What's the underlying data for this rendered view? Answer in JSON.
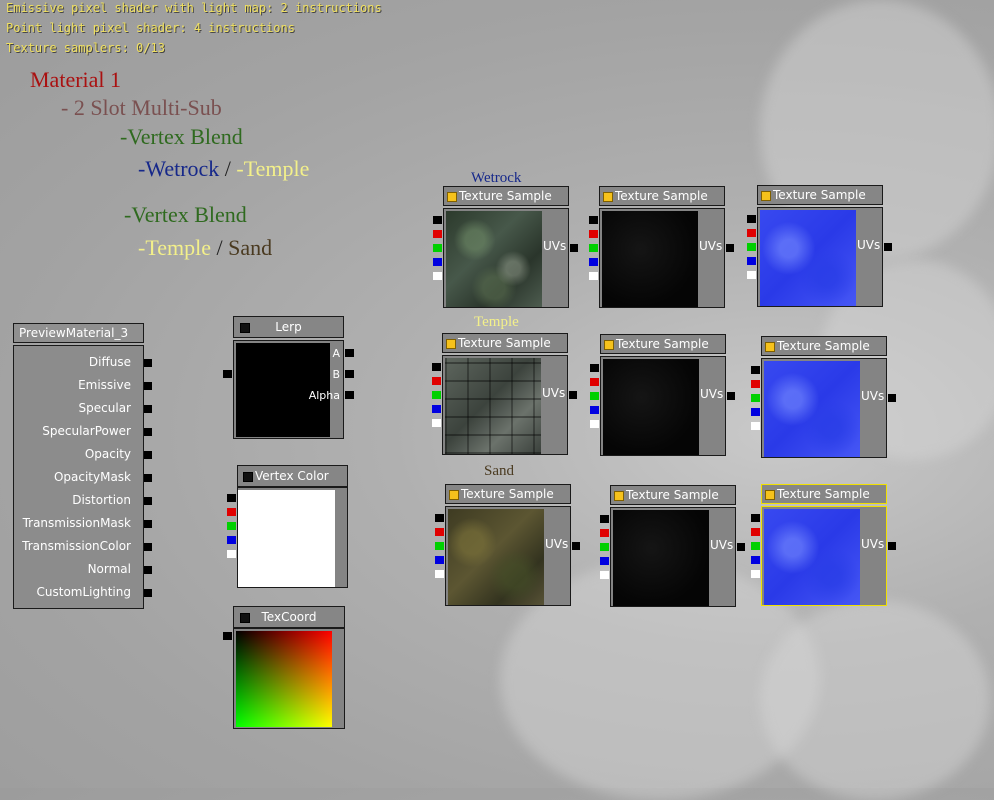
{
  "stats": {
    "line1": "Emissive pixel shader with light map: 2 instructions",
    "line2": "Point light pixel shader: 4 instructions",
    "line3": "Texture samplers: 0/13"
  },
  "notes": {
    "material": "Material 1",
    "multisub": "- 2 Slot Multi-Sub",
    "vertex_blend_1": "-Vertex Blend",
    "wetrock": "-Wetrock",
    "slash": " / ",
    "temple_1": "-Temple",
    "vertex_blend_2": "-Vertex Blend",
    "temple_2": "-Temple",
    "sand": "Sand"
  },
  "section_labels": {
    "wetrock": "Wetrock",
    "temple": "Temple",
    "sand": "Sand"
  },
  "preview_material": {
    "title": "PreviewMaterial_3",
    "inputs": [
      "Diffuse",
      "Emissive",
      "Specular",
      "SpecularPower",
      "Opacity",
      "OpacityMask",
      "Distortion",
      "TransmissionMask",
      "TransmissionColor",
      "Normal",
      "CustomLighting"
    ]
  },
  "lerp": {
    "title": "Lerp",
    "inputs": [
      "A",
      "B",
      "Alpha"
    ]
  },
  "vertex_color": {
    "title": "Vertex Color"
  },
  "texcoord": {
    "title": "TexCoord"
  },
  "texture_sample": {
    "title": "Texture Sample",
    "uvs_label": "UVs"
  },
  "colors": {
    "material": "#aa1111",
    "multisub": "#7a5050",
    "vertex_blend": "#2f6a1f",
    "wetrock": "#16288a",
    "temple": "#f3f08a",
    "sand": "#4a3a20",
    "stats_text": "#f0e060",
    "selected_border": "#f0e000"
  },
  "icons": {
    "output_square": "black-square",
    "header_square": "yellow-square"
  }
}
